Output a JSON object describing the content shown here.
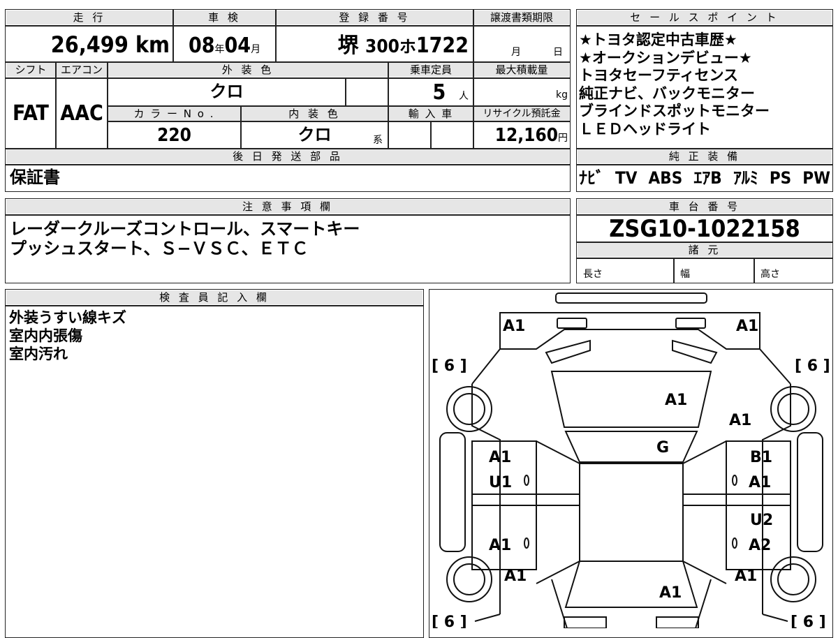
{
  "top": {
    "labels": {
      "mileage": "走 行",
      "inspection": "車 検",
      "registration": "登 録 番 号",
      "transfer_deadline": "譲渡書類期限"
    },
    "mileage_value": "26,499",
    "mileage_unit": "km",
    "inspection_year": "08",
    "year_unit": "年",
    "inspection_month": "04",
    "month_unit": "月",
    "reg_area": "堺",
    "reg_class": "300",
    "reg_kana": "ホ",
    "reg_number": "1722",
    "deadline_month_unit": "月",
    "deadline_day_unit": "日"
  },
  "spec": {
    "labels": {
      "shift": "シフト",
      "aircon": "エアコン",
      "exterior_color": "外 装 色",
      "capacity": "乗車定員",
      "max_load": "最大積載量",
      "color_no": "カ ラ ー N o .",
      "interior_color": "内 装 色",
      "imported": "輸 入 車",
      "recycle_fee": "リサイクル預託金"
    },
    "shift": "FAT",
    "aircon": "AAC",
    "exterior_color": "クロ",
    "capacity": "5",
    "capacity_unit": "人",
    "max_load_unit": "kg",
    "color_no": "220",
    "interior_color": "クロ",
    "interior_suffix": "系",
    "recycle_fee": "12,160",
    "recycle_unit": "円"
  },
  "later_parts": {
    "label": "後 日 発 送 部 品",
    "value": "保証書"
  },
  "sales_points": {
    "label": "セ ー ル ス ポ イ ン ト",
    "lines": [
      "★トヨタ認定中古車歴★",
      "★オークションデビュー★",
      "トヨタセーフティセンス",
      "純正ナビ、バックモニター",
      "ブラインドスポットモニター",
      "ＬＥＤヘッドライト"
    ]
  },
  "equipment": {
    "label": "純 正 装 備",
    "items": [
      "ﾅﾋﾞ",
      "TV",
      "ABS",
      "ｴｱB",
      "ｱﾙﾐ",
      "PS",
      "PW"
    ]
  },
  "notes": {
    "label": "注 意 事 項 欄",
    "lines": [
      "レーダークルーズコントロール、スマートキー",
      "プッシュスタート、Ｓ−ＶＳＣ、ＥＴＣ"
    ]
  },
  "chassis": {
    "label": "車 台 番 号",
    "value": "ZSG10-1022158"
  },
  "specs_dim": {
    "label": "諸 元",
    "length": "長さ",
    "width": "幅",
    "height": "高さ"
  },
  "inspector": {
    "label": "検 査 員 記 入 欄",
    "lines": [
      "外装うすい線キズ",
      "室内内張傷",
      "室内汚れ"
    ]
  },
  "diagram": {
    "tire_mark": "[ 6 ]",
    "rear_left": "A1",
    "rear_right": "A1",
    "trunk": "A1",
    "rear_quarter_right": "A1",
    "roof_glass": "G",
    "rear_door_left_1": "A1",
    "rear_door_left_2": "U1",
    "rear_door_right_1": "B1",
    "rear_door_right_2": "A1",
    "front_door_left": "A1",
    "front_door_right_1": "U2",
    "front_door_right_2": "A2",
    "fender_left": "A1",
    "fender_right": "A1",
    "hood": "A1"
  }
}
